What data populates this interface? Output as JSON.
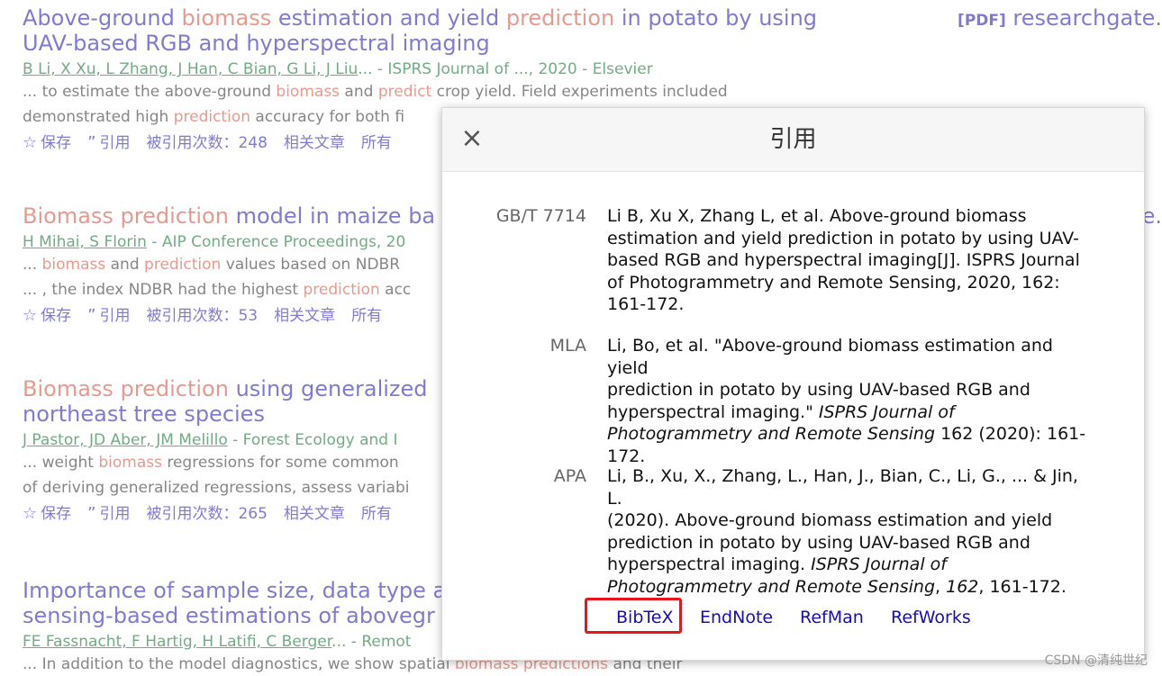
{
  "results": [
    {
      "title_parts": [
        {
          "t": "Above-ground ",
          "hl": false
        },
        {
          "t": "biomass",
          "hl": true
        },
        {
          "t": " estimation and yield ",
          "hl": false
        },
        {
          "t": "prediction",
          "hl": true
        },
        {
          "t": " in potato by using",
          "hl": false
        }
      ],
      "title_line2": "UAV-based RGB and hyperspectral imaging",
      "pdf_tag": "[PDF]",
      "pdf_source": "researchgate.",
      "authors": "B Li, X Xu, L Zhang, J Han, C Bian, G Li, J Liu",
      "source": "... - ISPRS Journal of ..., 2020 - Elsevier",
      "snippet1_parts": [
        {
          "t": "... to estimate the above-ground ",
          "hl": false
        },
        {
          "t": "biomass",
          "hl": true
        },
        {
          "t": " and ",
          "hl": false
        },
        {
          "t": "predict",
          "hl": true
        },
        {
          "t": " crop yield. Field experiments included",
          "hl": false
        }
      ],
      "snippet2_parts": [
        {
          "t": "demonstrated high ",
          "hl": false
        },
        {
          "t": "prediction",
          "hl": true
        },
        {
          "t": " accuracy for both fi",
          "hl": false
        }
      ],
      "save": "保存",
      "cite": "引用",
      "cited_by": "被引用次数：",
      "cited_count": "248",
      "related": "相关文章",
      "all": "所有"
    },
    {
      "title_parts": [
        {
          "t": "Biomass prediction",
          "hl": true
        },
        {
          "t": " model in maize ba",
          "hl": false
        }
      ],
      "title_line2": "",
      "pdf_source": "e.",
      "authors": "H Mihai, S Florin",
      "source": " - AIP Conference Proceedings, 20",
      "snippet1_parts": [
        {
          "t": "... ",
          "hl": false
        },
        {
          "t": "biomass",
          "hl": true
        },
        {
          "t": " and ",
          "hl": false
        },
        {
          "t": "prediction",
          "hl": true
        },
        {
          "t": " values based on NDBR",
          "hl": false
        }
      ],
      "snippet2_parts": [
        {
          "t": "... , the index NDBR had the highest ",
          "hl": false
        },
        {
          "t": "prediction",
          "hl": true
        },
        {
          "t": " acc",
          "hl": false
        }
      ],
      "save": "保存",
      "cite": "引用",
      "cited_by": "被引用次数：",
      "cited_count": "53",
      "related": "相关文章",
      "all": "所有"
    },
    {
      "title_parts": [
        {
          "t": "Biomass prediction",
          "hl": true
        },
        {
          "t": " using generalized",
          "hl": false
        }
      ],
      "title_line2": "northeast tree species",
      "authors": "J Pastor, JD Aber, JM Melillo",
      "source": " - Forest Ecology and I",
      "snippet1_parts": [
        {
          "t": "... weight ",
          "hl": false
        },
        {
          "t": "biomass",
          "hl": true
        },
        {
          "t": " regressions for some common",
          "hl": false
        }
      ],
      "snippet2_parts": [
        {
          "t": "of deriving generalized regressions, assess variabi",
          "hl": false
        }
      ],
      "save": "保存",
      "cite": "引用",
      "cited_by": "被引用次数：",
      "cited_count": "265",
      "related": "相关文章",
      "all": "所有"
    },
    {
      "title_parts": [
        {
          "t": "Importance of sample size, data type a",
          "hl": false
        }
      ],
      "title_line2": "sensing-based estimations of abovegr",
      "authors": "FE Fassnacht, F Hartig, H Latifi, C Berger",
      "source": "... - Remot",
      "snippet1_parts": [
        {
          "t": "... In addition to the model diagnostics, we show spatial ",
          "hl": false
        },
        {
          "t": "biomass predictions",
          "hl": true
        },
        {
          "t": " and their",
          "hl": false
        }
      ]
    }
  ],
  "modal": {
    "title": "引用",
    "close_label": "×",
    "citations": [
      {
        "label": "GB/T 7714",
        "lines": [
          "Li B, Xu X, Zhang L, et al. Above-ground biomass",
          "estimation and yield prediction in potato by using UAV-",
          "based RGB and hyperspectral imaging[J]. ISPRS Journal",
          "of Photogrammetry and Remote Sensing, 2020, 162:",
          "161-172."
        ]
      },
      {
        "label": "MLA",
        "line1": "Li, Bo, et al. \"Above-ground biomass estimation and yield",
        "line2": "prediction in potato by using UAV-based RGB and",
        "line3_plain": "hyperspectral imaging.\" ",
        "line3_italic": "ISPRS Journal of",
        "line4_italic": "Photogrammetry and Remote Sensing",
        "line4_plain": " 162 (2020): 161-",
        "line5": "172."
      },
      {
        "label": "APA",
        "line1": "Li, B., Xu, X., Zhang, L., Han, J., Bian, C., Li, G., ... & Jin, L.",
        "line2": "(2020). Above-ground biomass estimation and yield",
        "line3": "prediction in potato by using UAV-based RGB and",
        "line4_plain": "hyperspectral imaging. ",
        "line4_italic": "ISPRS Journal of",
        "line5_italic": "Photogrammetry and Remote Sensing",
        "line5_plain_a": ", ",
        "line5_italic_b": "162",
        "line5_plain_b": ", 161-172."
      }
    ],
    "export_links": [
      "BibTeX",
      "EndNote",
      "RefMan",
      "RefWorks"
    ]
  },
  "watermark": "CSDN @清纯世纪",
  "colors": {
    "link": "#1a0dab",
    "highlight": "#d14836",
    "author_green": "#006621",
    "annotation_red": "#e8161b"
  }
}
